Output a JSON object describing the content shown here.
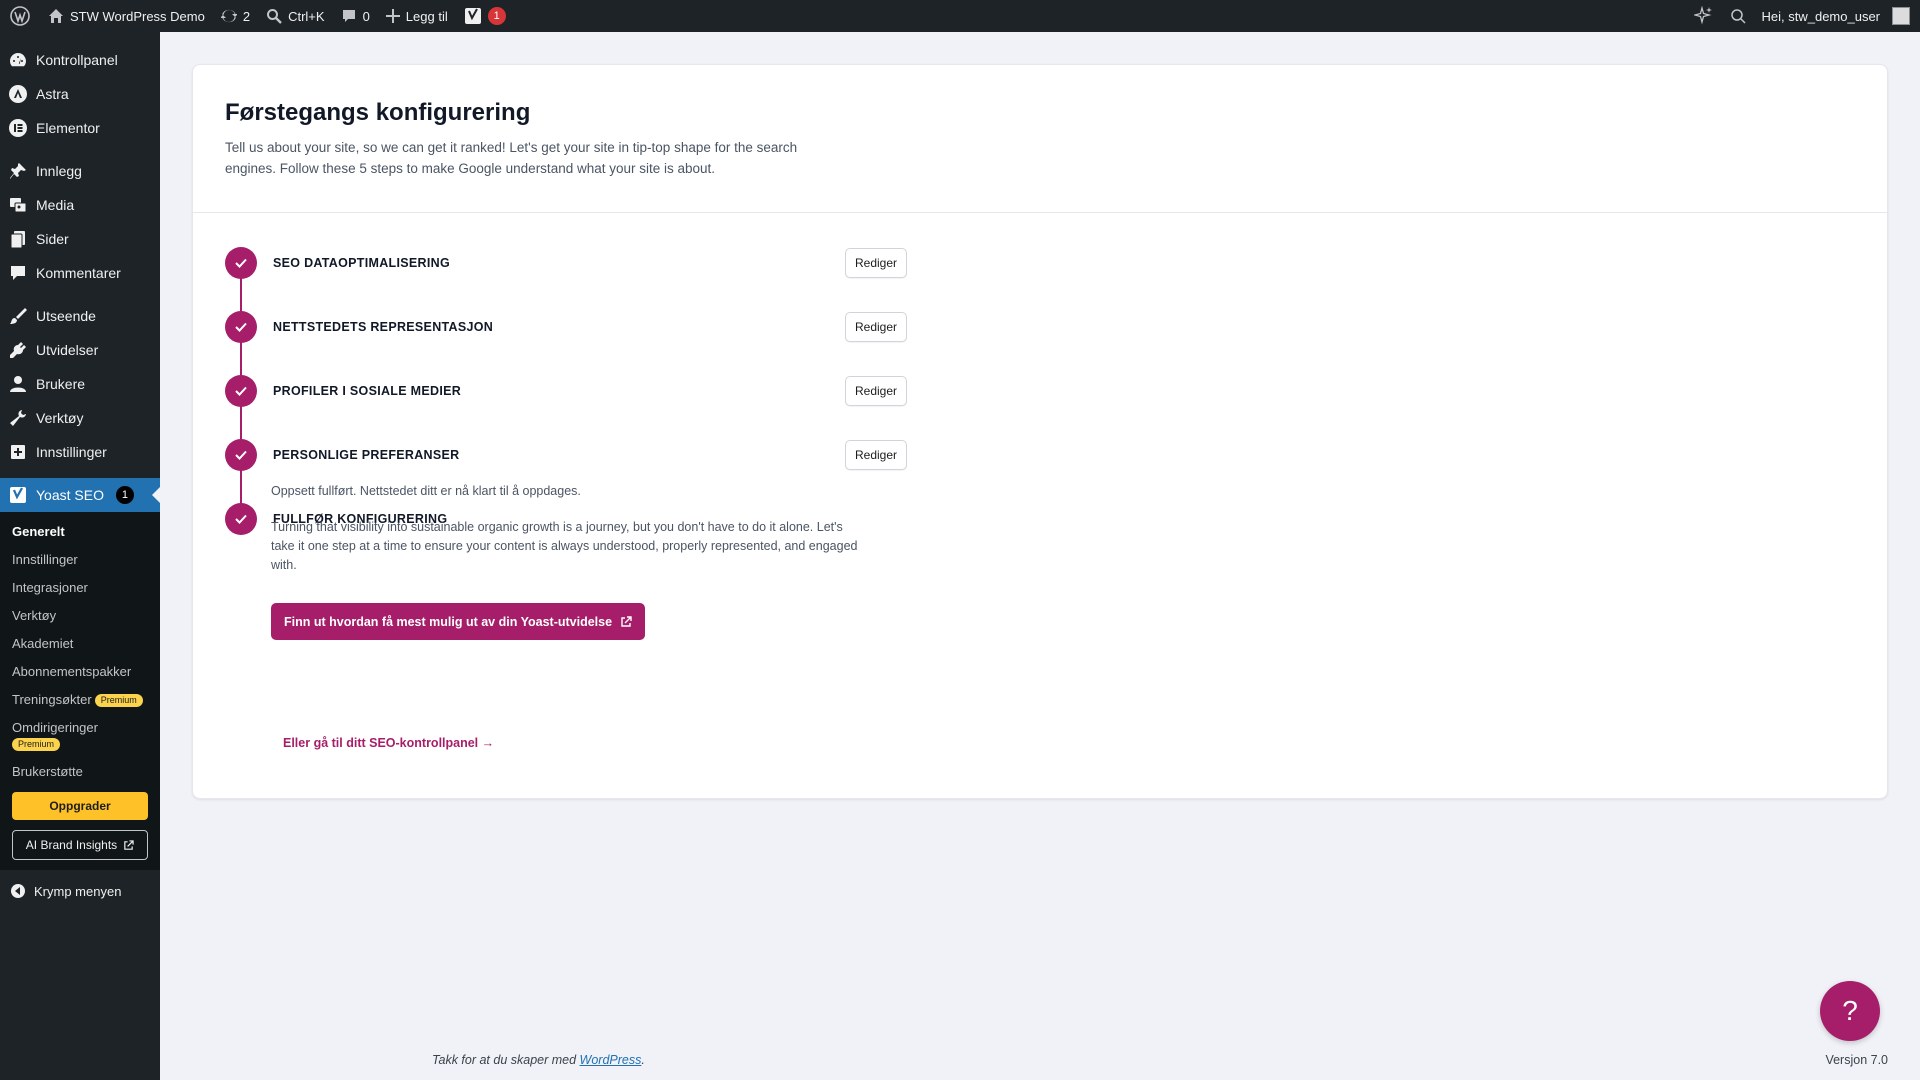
{
  "adminbar": {
    "site_name": "STW WordPress Demo",
    "updates_count": "2",
    "search_shortcut": "Ctrl+K",
    "comments_count": "0",
    "new_label": "Legg til",
    "yoast_badge": "1",
    "greeting": "Hei, stw_demo_user"
  },
  "sidebar": {
    "items": [
      {
        "label": "Kontrollpanel"
      },
      {
        "label": "Astra"
      },
      {
        "label": "Elementor"
      },
      {
        "label": "Innlegg"
      },
      {
        "label": "Media"
      },
      {
        "label": "Sider"
      },
      {
        "label": "Kommentarer"
      },
      {
        "label": "Utseende"
      },
      {
        "label": "Utvidelser"
      },
      {
        "label": "Brukere"
      },
      {
        "label": "Verktøy"
      },
      {
        "label": "Innstillinger"
      }
    ],
    "yoast": {
      "label": "Yoast SEO",
      "badge": "1"
    },
    "submenu": [
      {
        "label": "Generelt"
      },
      {
        "label": "Innstillinger"
      },
      {
        "label": "Integrasjoner"
      },
      {
        "label": "Verktøy"
      },
      {
        "label": "Akademiet"
      },
      {
        "label": "Abonnementspakker"
      },
      {
        "label": "Treningsøkter",
        "badge": "Premium"
      },
      {
        "label": "Omdirigeringer",
        "badge": "Premium"
      },
      {
        "label": "Brukerstøtte"
      }
    ],
    "upgrade_label": "Oppgrader",
    "ai_label": "AI Brand Insights",
    "collapse_label": "Krymp menyen"
  },
  "main": {
    "title": "Førstegangs konfigurering",
    "intro": "Tell us about your site, so we can get it ranked! Let's get your site in tip-top shape for the search engines. Follow these 5 steps to make Google understand what your site is about.",
    "edit_label": "Rediger",
    "steps": [
      {
        "title": "SEO DATAOPTIMALISERING"
      },
      {
        "title": "NETTSTEDETS REPRESENTASJON"
      },
      {
        "title": "PROFILER I SOSIALE MEDIER"
      },
      {
        "title": "PERSONLIGE PREFERANSER"
      },
      {
        "title": "FULLFØR KONFIGURERING"
      }
    ],
    "done_text": "Oppsett fullført. Nettstedet ditt er nå klart til å oppdages.",
    "journey_text": "Turning that visibility into sustainable organic growth is a journey, but you don't have to do it alone. Let's take it one step at a time to ensure your content is always understood, properly represented, and engaged with.",
    "cta_label": "Finn ut hvordan få mest mulig ut av din Yoast-utvidelse",
    "dashboard_link": "Eller gå til ditt SEO-kontrollpanel"
  },
  "footer": {
    "thanks": "Takk for at du skaper med ",
    "wp_link": "WordPress",
    "period": ".",
    "version": "Versjon 7.0"
  },
  "help_label": "?",
  "colors": {
    "accent": "#a61e69",
    "sidebar": "#1d2327",
    "active": "#2271b1"
  }
}
